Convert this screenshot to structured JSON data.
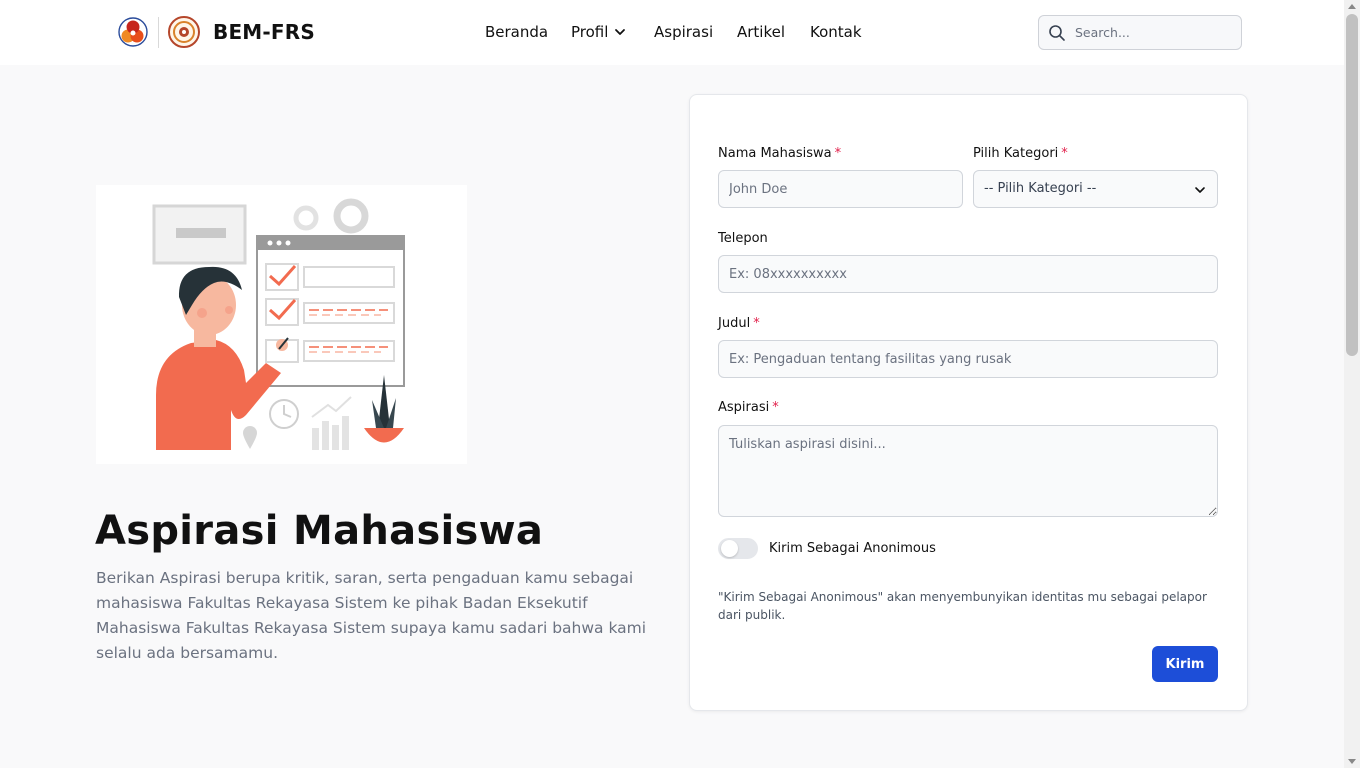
{
  "header": {
    "brand": "BEM-FRS",
    "nav": [
      {
        "label": "Beranda"
      },
      {
        "label": "Profil"
      },
      {
        "label": "Aspirasi"
      },
      {
        "label": "Artikel"
      },
      {
        "label": "Kontak"
      }
    ],
    "search_placeholder": "Search..."
  },
  "hero": {
    "title": "Aspirasi Mahasiswa",
    "description": "Berikan Aspirasi berupa kritik, saran, serta pengaduan kamu sebagai mahasiswa Fakultas Rekayasa Sistem ke pihak Badan Eksekutif Mahasiswa Fakultas Rekayasa Sistem supaya kamu sadari bahwa kami selalu ada bersamamu."
  },
  "form": {
    "nama": {
      "label": "Nama Mahasiswa",
      "required": "*",
      "placeholder": "John Doe",
      "value": ""
    },
    "kategori": {
      "label": "Pilih Kategori",
      "required": "*",
      "selected": "-- Pilih Kategori --"
    },
    "telepon": {
      "label": "Telepon",
      "placeholder": "Ex: 08xxxxxxxxxx",
      "value": ""
    },
    "judul": {
      "label": "Judul",
      "required": "*",
      "placeholder": "Ex: Pengaduan tentang fasilitas yang rusak",
      "value": ""
    },
    "aspirasi": {
      "label": "Aspirasi",
      "required": "*",
      "placeholder": "Tuliskan aspirasi disini...",
      "value": ""
    },
    "anonymous": {
      "label": "Kirim Sebagai Anonimous",
      "checked": false
    },
    "note": "\"Kirim Sebagai Anonimous\" akan menyembunyikan identitas mu sebagai pelapor dari publik.",
    "submit_label": "Kirim"
  },
  "colors": {
    "accent": "#1d4ed8",
    "required": "#e11d48",
    "illustration_orange": "#f26b4f"
  },
  "icons": {
    "logo_primary": "hexagon-cluster-logo",
    "logo_secondary": "round-seal-logo",
    "profil_dropdown": "chevron-down-icon",
    "search": "search-icon",
    "kategori_dropdown": "chevron-down-icon"
  }
}
